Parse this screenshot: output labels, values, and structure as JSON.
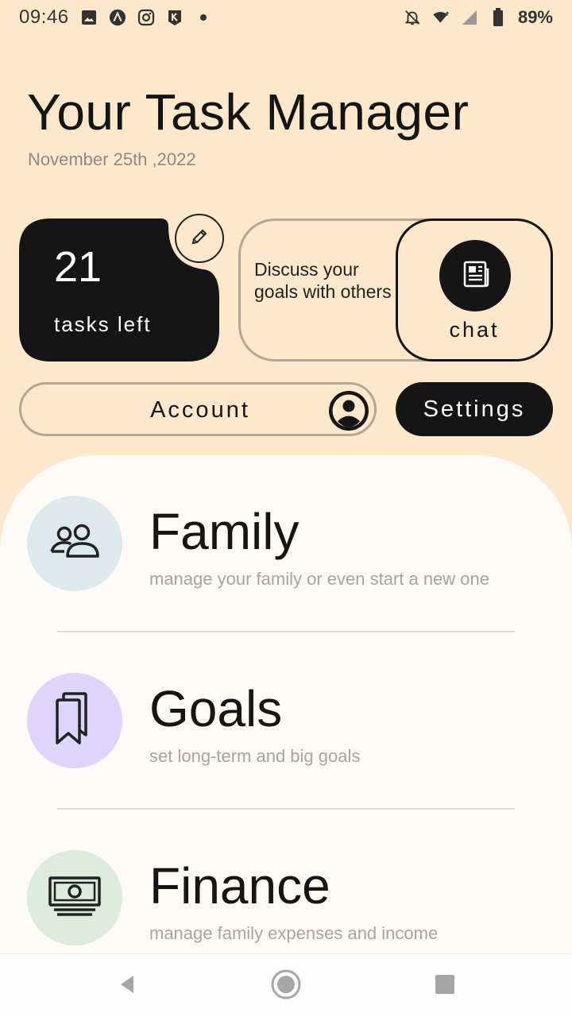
{
  "status_bar": {
    "time": "09:46",
    "battery": "89%",
    "left_icons": [
      "image-icon",
      "app-icon",
      "instagram-icon",
      "app-icon-2",
      "dot-icon"
    ],
    "right_icons": [
      "bell-off-icon",
      "wifi-icon",
      "signal-icon",
      "battery-icon"
    ]
  },
  "header": {
    "title": "Your Task Manager",
    "date": "November 25th ,2022"
  },
  "tasks_card": {
    "count": "21",
    "label": "tasks left",
    "edit_icon": "pencil-icon"
  },
  "chat_card": {
    "text": "Discuss your goals with others",
    "button_label": "chat",
    "icon": "newspaper-icon"
  },
  "account": {
    "label": "Account",
    "icon": "user-circle-icon"
  },
  "settings": {
    "label": "Settings"
  },
  "categories": [
    {
      "title": "Family",
      "description": "manage your family or even start a new one",
      "icon": "people-icon",
      "color": "#dde9ea"
    },
    {
      "title": "Goals",
      "description": "set long-term and big goals",
      "icon": "bookmarks-icon",
      "color": "#ddd5fb"
    },
    {
      "title": "Finance",
      "description": "manage family expenses and income",
      "icon": "money-icon",
      "color": "#dcebdc"
    }
  ],
  "colors": {
    "background": "#fde8cc",
    "dark": "#151515",
    "sheet": "#fdfaf7",
    "muted_border": "#b4a694"
  },
  "nav_bar": {
    "buttons": [
      "back-icon",
      "home-icon",
      "recents-icon"
    ]
  }
}
